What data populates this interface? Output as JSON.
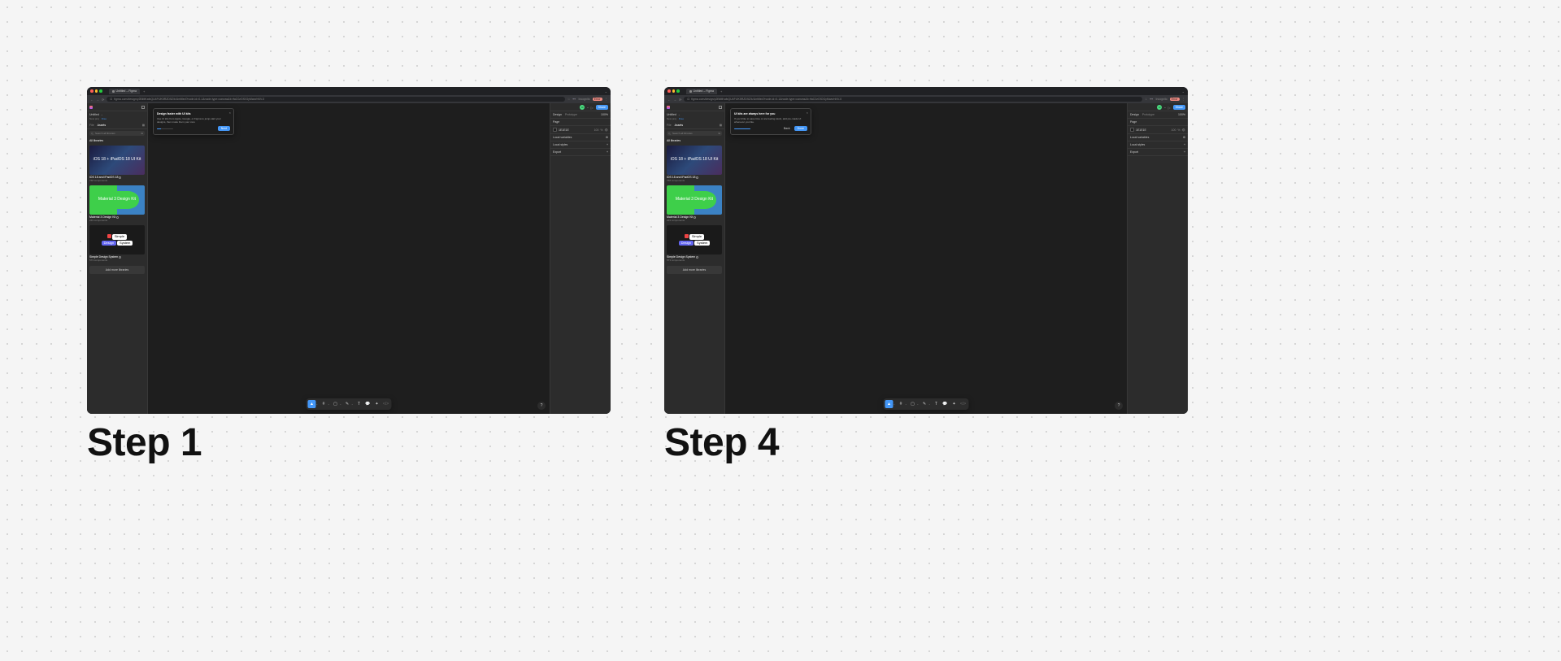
{
  "steps": [
    {
      "label": "Step 1"
    },
    {
      "label": "Step 4"
    }
  ],
  "browser": {
    "tab_title": "Untitled – Figma",
    "url": "figma.com/design/y2BiMKafcQU4FtJK5RZD5Z/k/Untitled?node-id=0-1&node-type=canvas&t=rfaC0zGfOGyMwurhNV-0",
    "incognito": "Incognito",
    "error": "Error"
  },
  "figma": {
    "file_title": "Untitled",
    "team": "New proj",
    "plan": "Free",
    "tab_file": "File",
    "tab_assets": "Assets",
    "search_placeholder": "Search all libraries",
    "section_label": "All libraries",
    "add_more": "Add more libraries",
    "libraries": [
      {
        "name": "iOS 18 and iPadOS 18",
        "count": "768 components",
        "thumb_text": "iOS 18 + iPadOS 18\nUI Kit",
        "thumb_class": "ios"
      },
      {
        "name": "Material 3 Design Kit",
        "count": "249 components",
        "thumb_text": "Material 3\nDesign Kit",
        "thumb_class": "material"
      },
      {
        "name": "Simple Design System",
        "count": "573 components",
        "thumb_text": "Simple Design System",
        "thumb_class": "simple"
      }
    ],
    "right": {
      "avatar": "O",
      "share": "Share",
      "tab_design": "Design",
      "tab_prototype": "Prototype",
      "zoom": "100%",
      "page": "Page",
      "bg_hex": "1E1E1E",
      "bg_pct": "100",
      "local_vars": "Local variables",
      "local_styles": "Local styles",
      "export": "Export"
    },
    "toolbar_icons": [
      "move",
      "frame",
      "rect",
      "pen",
      "text",
      "comment",
      "actions",
      "dev"
    ]
  },
  "popovers": {
    "step1": {
      "title": "Design faster with UI kits",
      "body": "Use UI kits from Apple, Google, or Figma to jump-start your designs, then make them your own.",
      "next": "Next",
      "progress_pct": 25
    },
    "step4": {
      "title": "UI kits are always here for you",
      "body": "If you'd like to save time or are feeling stuck, add pre-made UI whenever you like.",
      "back": "Back",
      "done": "Done",
      "progress_pct": 100
    }
  }
}
